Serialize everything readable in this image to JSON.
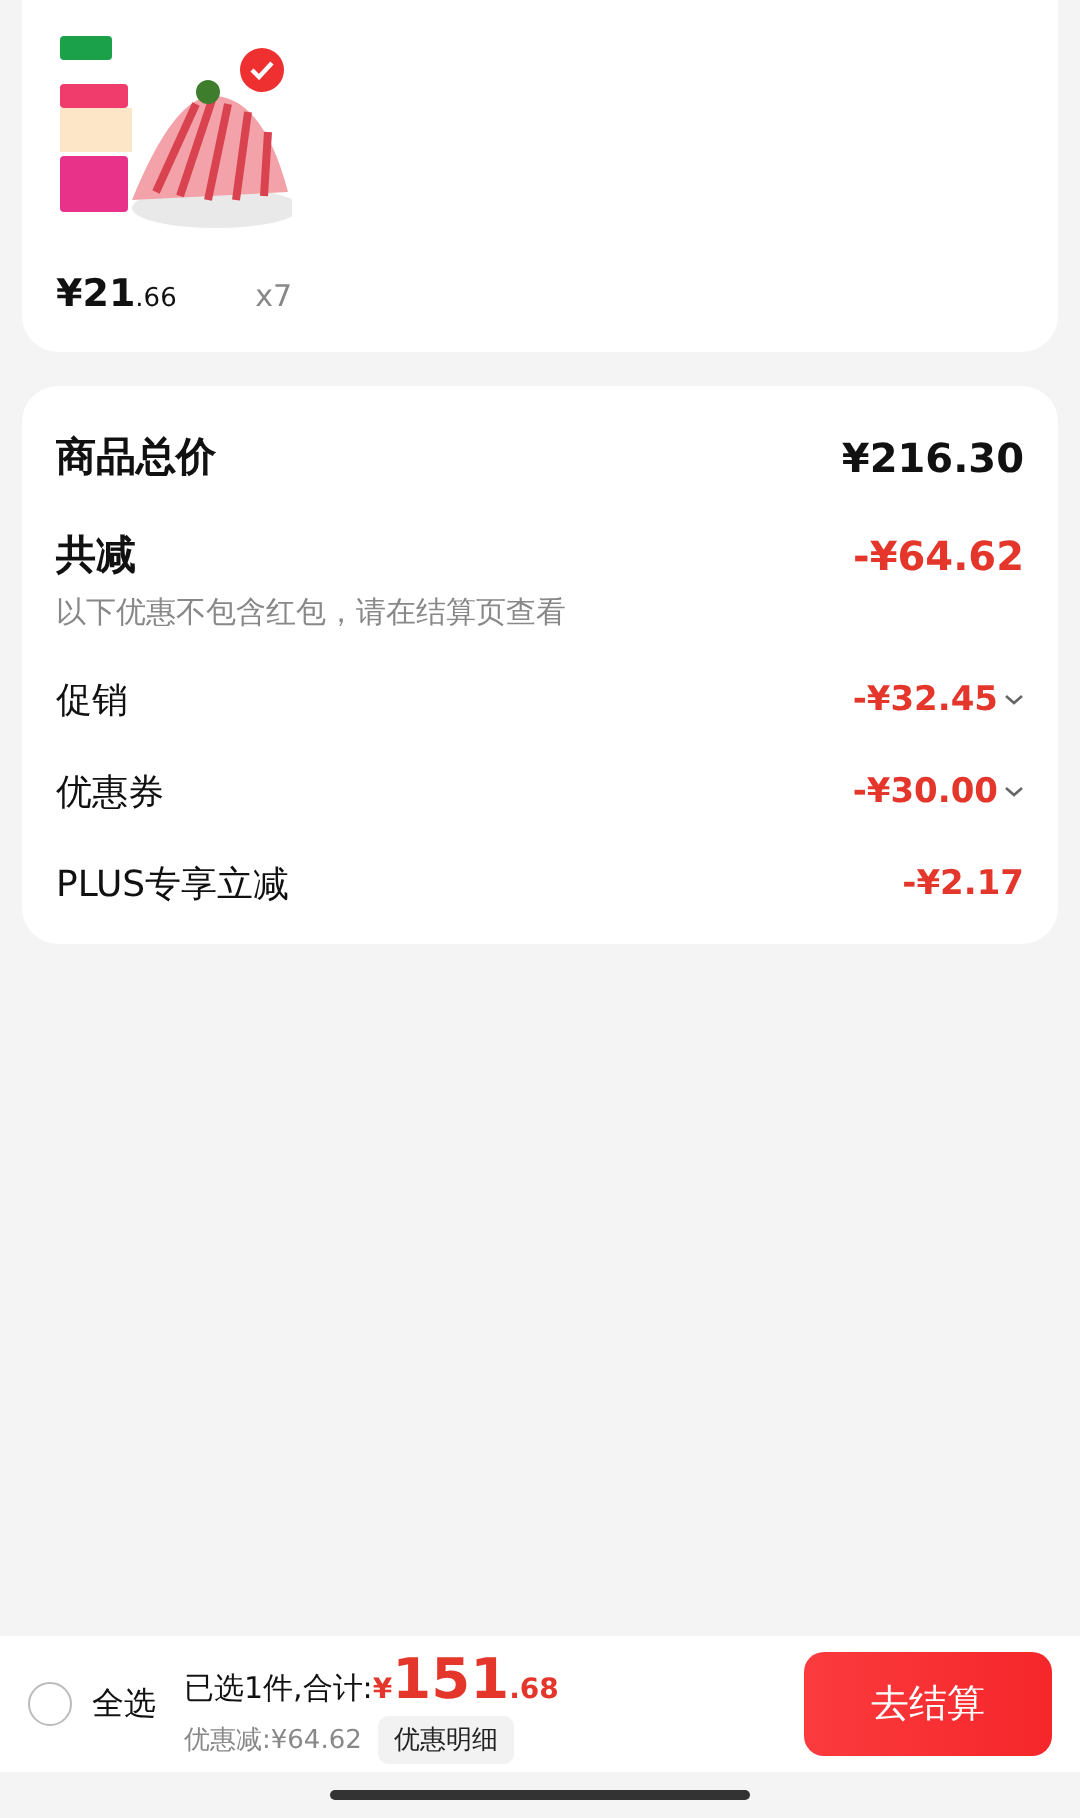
{
  "product": {
    "selected": true,
    "price": {
      "integer": "¥21",
      "decimal": ".66"
    },
    "quantity": "x7"
  },
  "summary": {
    "rows": [
      {
        "kind": "total",
        "label": "商品总价",
        "value": "¥216.30"
      },
      {
        "kind": "reduction",
        "label": "共减",
        "value": "-¥64.62",
        "note": "以下优惠不包含红包，请在结算页查看"
      },
      {
        "kind": "detail",
        "label": "促销",
        "value": "-¥32.45",
        "expandable": true
      },
      {
        "kind": "detail",
        "label": "优惠券",
        "value": "-¥30.00",
        "expandable": true
      },
      {
        "kind": "detail",
        "label": "PLUS专享立减",
        "value": "-¥2.17",
        "expandable": false
      }
    ]
  },
  "bottom_bar": {
    "select_all": {
      "label": "全选",
      "selected": false
    },
    "selected_count": "已选1件,合计:",
    "total": {
      "symbol": "¥",
      "integer": "151",
      "decimal": ".68"
    },
    "discount": "优惠减:¥64.62",
    "details_button": "优惠明细",
    "checkout_button": "去结算"
  }
}
